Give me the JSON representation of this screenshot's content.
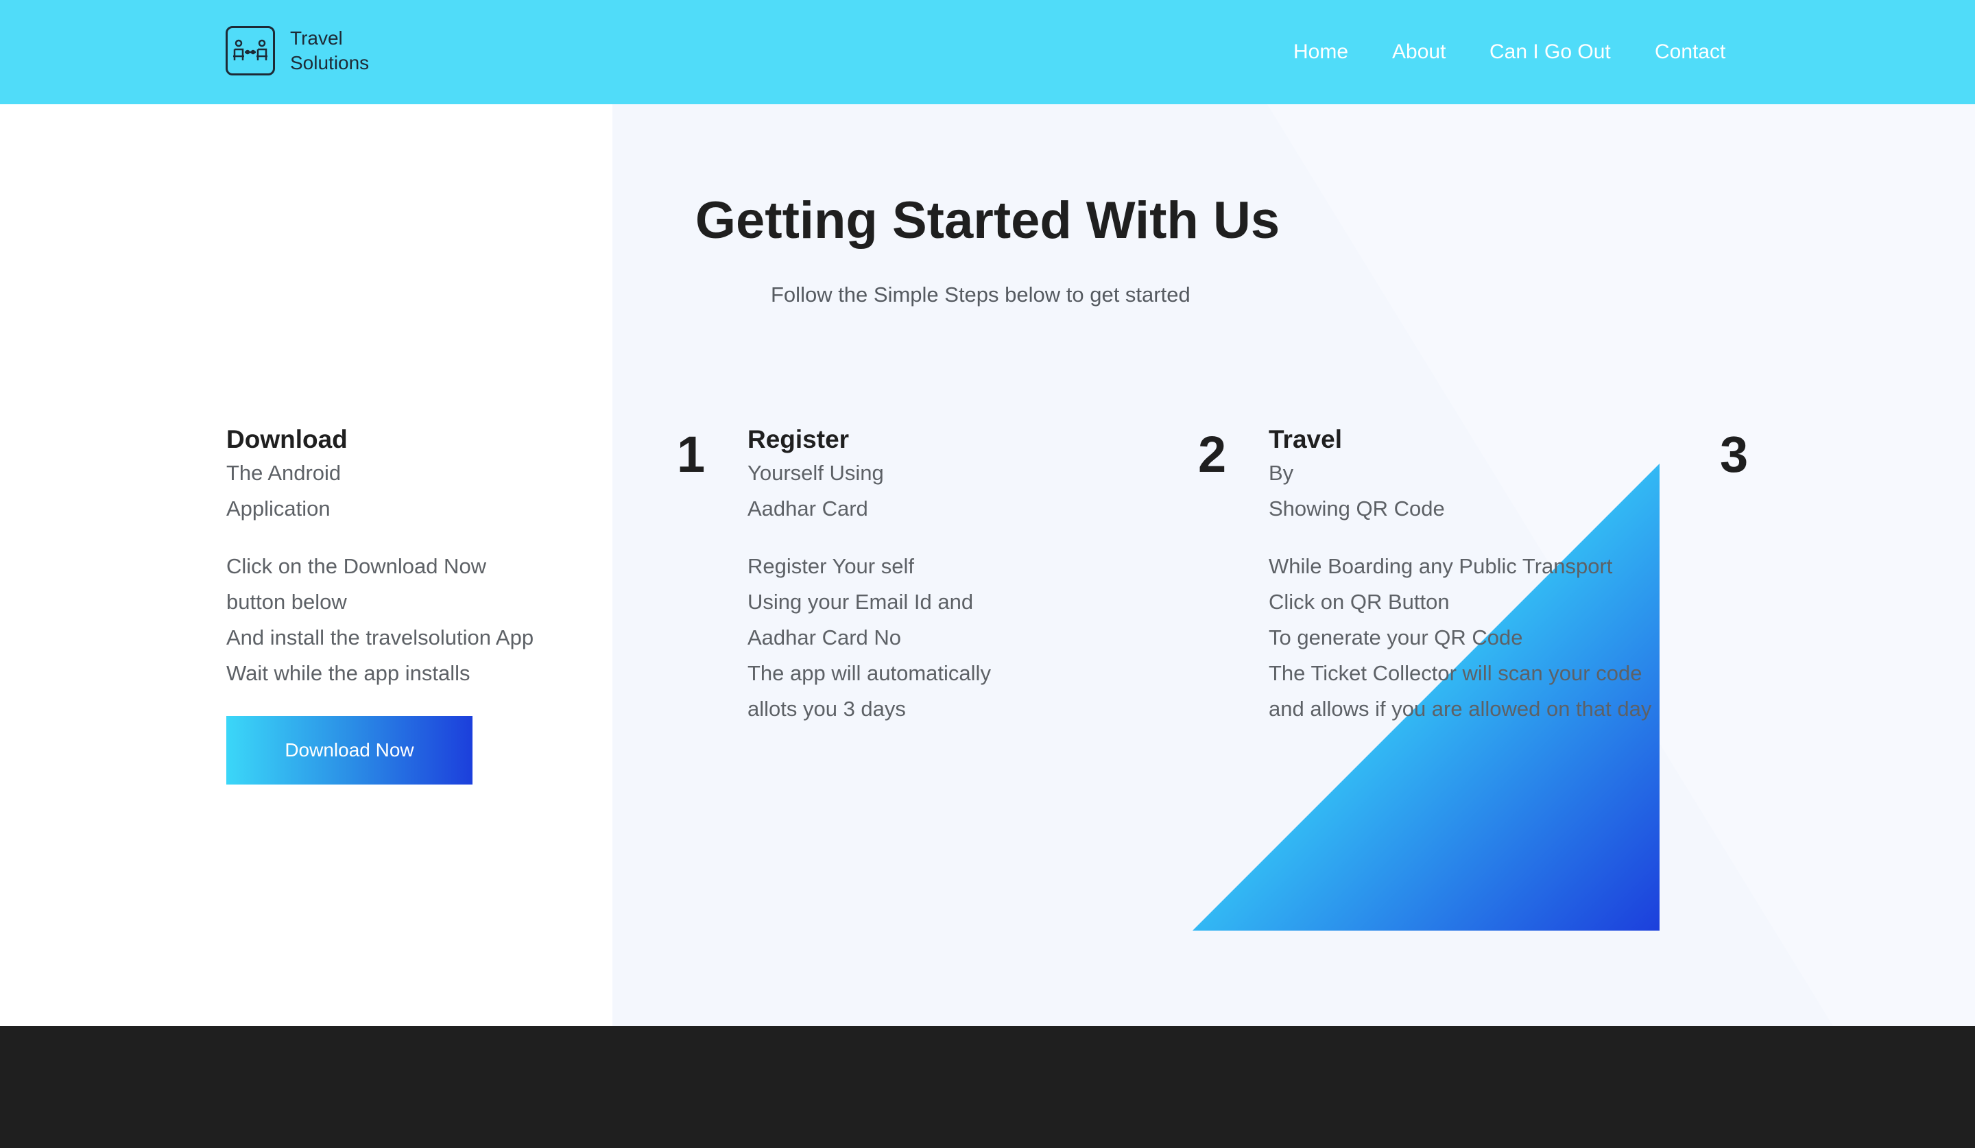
{
  "header": {
    "logo_line1": "Travel",
    "logo_line2": "Solutions",
    "logo_icon": "bus-seats-icon",
    "nav": [
      "Home",
      "About",
      "Can I Go Out",
      "Contact"
    ]
  },
  "hero": {
    "title": "Getting Started With Us",
    "subtitle": "Follow the Simple Steps below to get started"
  },
  "steps": [
    {
      "heading": "Download",
      "tagline": [
        "The Android",
        "Application"
      ],
      "description": [
        "Click on the Download Now",
        "button below",
        "And install the travelsolution App",
        "Wait while the app installs"
      ],
      "number": "1"
    },
    {
      "heading": "Register",
      "tagline": [
        "Yourself Using",
        "Aadhar Card"
      ],
      "description": [
        "Register Your self",
        "Using your Email Id and",
        "Aadhar Card No",
        "The app will automatically",
        "allots you 3 days"
      ],
      "number": "2"
    },
    {
      "heading": "Travel",
      "tagline": [
        "By",
        "Showing QR Code"
      ],
      "description": [
        "While Boarding any Public Transport",
        "Click on QR Button",
        "To generate your QR Code",
        "The Ticket Collector will scan your code",
        "and allows if you are allowed on that day"
      ],
      "number": "3"
    }
  ],
  "download_button_label": "Download Now",
  "colors": {
    "header_bg": "#50dcf9",
    "footer_bg": "#1f1f1f",
    "gradient_start": "#3bd7f8",
    "gradient_end": "#1c3fdc"
  }
}
